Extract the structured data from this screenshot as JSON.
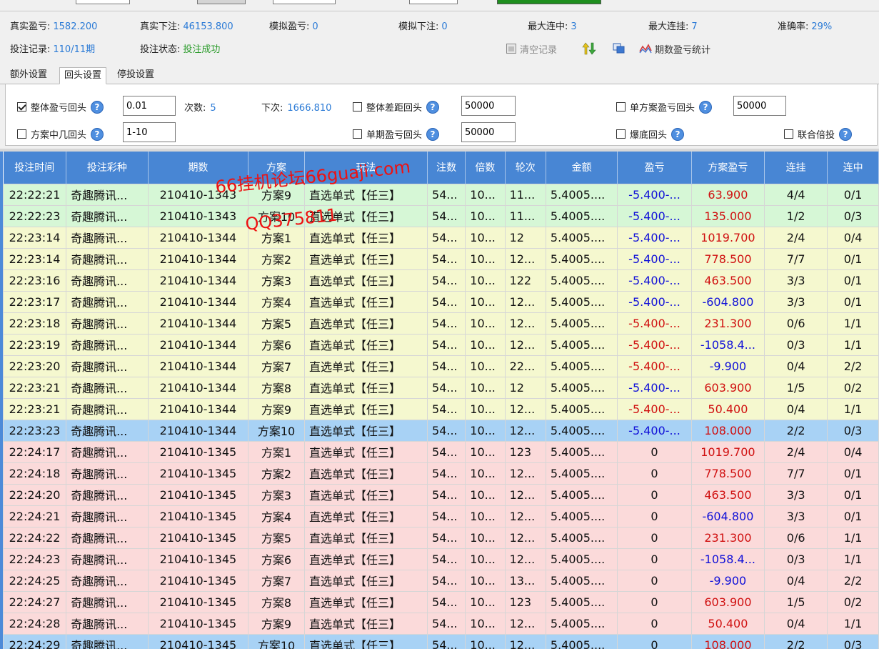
{
  "stats": {
    "row1": [
      {
        "label": "真实盈亏:",
        "value": "1582.200"
      },
      {
        "label": "真实下注:",
        "value": "46153.800"
      },
      {
        "label": "模拟盈亏:",
        "value": "0"
      },
      {
        "label": "模拟下注:",
        "value": "0"
      },
      {
        "label": "最大连中:",
        "value": "3"
      },
      {
        "label": "最大连挂:",
        "value": "7"
      },
      {
        "label": "准确率:",
        "value": "29%"
      }
    ],
    "row2": [
      {
        "label": "投注记录:",
        "value": "110/11期"
      },
      {
        "label": "投注状态:",
        "value": "投注成功"
      }
    ]
  },
  "toolbar": {
    "clear_label": "清空记录",
    "stats_label": "期数盈亏统计"
  },
  "tabs": [
    {
      "label": "额外设置",
      "active": false
    },
    {
      "label": "回头设置",
      "active": true
    },
    {
      "label": "停投设置",
      "active": false
    }
  ],
  "settings": {
    "overall_profit_return": {
      "label": "整体盈亏回头",
      "checked": true,
      "value": "0.01"
    },
    "count": {
      "label": "次数:",
      "value": "5"
    },
    "next": {
      "label": "下次:",
      "value": "1666.810"
    },
    "overall_gap_return": {
      "label": "整体差距回头",
      "checked": false,
      "value": "50000"
    },
    "single_plan_return": {
      "label": "单方案盈亏回头",
      "checked": false,
      "value": "50000"
    },
    "plan_hit_return": {
      "label": "方案中几回头",
      "checked": false,
      "value": "1-10"
    },
    "single_period_return": {
      "label": "单期盈亏回头",
      "checked": false,
      "value": "50000"
    },
    "bottom_out_return": {
      "label": "爆底回头",
      "checked": false
    },
    "joint_multiply": {
      "label": "联合倍投",
      "checked": false
    },
    "help_glyph": "?"
  },
  "table": {
    "columns": [
      "投注时间",
      "投注彩种",
      "期数",
      "方案",
      "玩法",
      "注数",
      "倍数",
      "轮次",
      "金额",
      "盈亏",
      "方案盈亏",
      "连挂",
      "连中"
    ],
    "rows": [
      {
        "time": "22:22:21",
        "lottery": "奇趣腾讯...",
        "period": "210410-1343",
        "plan": "方案9",
        "mode": "直选单式【任三】",
        "bets": "54...",
        "mult": "10...",
        "round": "11...",
        "amount": "5.4005....",
        "profit": "-5.400-...",
        "plan_profit": "63.900",
        "lose_streak": "4/4",
        "win_streak": "0/1",
        "style": "green",
        "profit_color": "blu",
        "plan_color": "neg"
      },
      {
        "time": "22:22:23",
        "lottery": "奇趣腾讯...",
        "period": "210410-1343",
        "plan": "方案10",
        "mode": "直选单式【任三】",
        "bets": "54...",
        "mult": "10...",
        "round": "11...",
        "amount": "5.4005....",
        "profit": "-5.400-...",
        "plan_profit": "135.000",
        "lose_streak": "1/2",
        "win_streak": "0/3",
        "style": "green",
        "profit_color": "blu",
        "plan_color": "neg"
      },
      {
        "time": "22:23:14",
        "lottery": "奇趣腾讯...",
        "period": "210410-1344",
        "plan": "方案1",
        "mode": "直选单式【任三】",
        "bets": "54...",
        "mult": "10...",
        "round": "12",
        "amount": "5.4005....",
        "profit": "-5.400-...",
        "plan_profit": "1019.700",
        "lose_streak": "2/4",
        "win_streak": "0/4",
        "style": "yellow",
        "profit_color": "blu",
        "plan_color": "neg"
      },
      {
        "time": "22:23:14",
        "lottery": "奇趣腾讯...",
        "period": "210410-1344",
        "plan": "方案2",
        "mode": "直选单式【任三】",
        "bets": "54...",
        "mult": "10...",
        "round": "12...",
        "amount": "5.4005....",
        "profit": "-5.400-...",
        "plan_profit": "778.500",
        "lose_streak": "7/7",
        "win_streak": "0/1",
        "style": "yellow",
        "profit_color": "blu",
        "plan_color": "neg"
      },
      {
        "time": "22:23:16",
        "lottery": "奇趣腾讯...",
        "period": "210410-1344",
        "plan": "方案3",
        "mode": "直选单式【任三】",
        "bets": "54...",
        "mult": "10...",
        "round": "122",
        "amount": "5.4005....",
        "profit": "-5.400-...",
        "plan_profit": "463.500",
        "lose_streak": "3/3",
        "win_streak": "0/1",
        "style": "yellow",
        "profit_color": "blu",
        "plan_color": "neg"
      },
      {
        "time": "22:23:17",
        "lottery": "奇趣腾讯...",
        "period": "210410-1344",
        "plan": "方案4",
        "mode": "直选单式【任三】",
        "bets": "54...",
        "mult": "10...",
        "round": "12...",
        "amount": "5.4005....",
        "profit": "-5.400-...",
        "plan_profit": "-604.800",
        "lose_streak": "3/3",
        "win_streak": "0/1",
        "style": "yellow",
        "profit_color": "blu",
        "plan_color": "blu"
      },
      {
        "time": "22:23:18",
        "lottery": "奇趣腾讯...",
        "period": "210410-1344",
        "plan": "方案5",
        "mode": "直选单式【任三】",
        "bets": "54...",
        "mult": "10...",
        "round": "12...",
        "amount": "5.4005....",
        "profit": "-5.400-...",
        "plan_profit": "231.300",
        "lose_streak": "0/6",
        "win_streak": "1/1",
        "style": "yellow",
        "profit_color": "neg",
        "plan_color": "neg"
      },
      {
        "time": "22:23:19",
        "lottery": "奇趣腾讯...",
        "period": "210410-1344",
        "plan": "方案6",
        "mode": "直选单式【任三】",
        "bets": "54...",
        "mult": "10...",
        "round": "12...",
        "amount": "5.4005....",
        "profit": "-5.400-...",
        "plan_profit": "-1058.4...",
        "lose_streak": "0/3",
        "win_streak": "1/1",
        "style": "yellow",
        "profit_color": "neg",
        "plan_color": "blu"
      },
      {
        "time": "22:23:20",
        "lottery": "奇趣腾讯...",
        "period": "210410-1344",
        "plan": "方案7",
        "mode": "直选单式【任三】",
        "bets": "54...",
        "mult": "10...",
        "round": "22...",
        "amount": "5.4005....",
        "profit": "-5.400-...",
        "plan_profit": "-9.900",
        "lose_streak": "0/4",
        "win_streak": "2/2",
        "style": "yellow",
        "profit_color": "neg",
        "plan_color": "blu"
      },
      {
        "time": "22:23:21",
        "lottery": "奇趣腾讯...",
        "period": "210410-1344",
        "plan": "方案8",
        "mode": "直选单式【任三】",
        "bets": "54...",
        "mult": "10...",
        "round": "12",
        "amount": "5.4005....",
        "profit": "-5.400-...",
        "plan_profit": "603.900",
        "lose_streak": "1/5",
        "win_streak": "0/2",
        "style": "yellow",
        "profit_color": "blu",
        "plan_color": "neg"
      },
      {
        "time": "22:23:21",
        "lottery": "奇趣腾讯...",
        "period": "210410-1344",
        "plan": "方案9",
        "mode": "直选单式【任三】",
        "bets": "54...",
        "mult": "10...",
        "round": "12...",
        "amount": "5.4005....",
        "profit": "-5.400-...",
        "plan_profit": "50.400",
        "lose_streak": "0/4",
        "win_streak": "1/1",
        "style": "yellow",
        "profit_color": "neg",
        "plan_color": "neg"
      },
      {
        "time": "22:23:23",
        "lottery": "奇趣腾讯...",
        "period": "210410-1344",
        "plan": "方案10",
        "mode": "直选单式【任三】",
        "bets": "54...",
        "mult": "10...",
        "round": "12...",
        "amount": "5.4005....",
        "profit": "-5.400-...",
        "plan_profit": "108.000",
        "lose_streak": "2/2",
        "win_streak": "0/3",
        "style": "blue",
        "profit_color": "blu",
        "plan_color": "neg"
      },
      {
        "time": "22:24:17",
        "lottery": "奇趣腾讯...",
        "period": "210410-1345",
        "plan": "方案1",
        "mode": "直选单式【任三】",
        "bets": "54...",
        "mult": "10...",
        "round": "123",
        "amount": "5.4005....",
        "profit": "0",
        "plan_profit": "1019.700",
        "lose_streak": "2/4",
        "win_streak": "0/4",
        "style": "pink",
        "profit_color": "",
        "plan_color": "neg"
      },
      {
        "time": "22:24:18",
        "lottery": "奇趣腾讯...",
        "period": "210410-1345",
        "plan": "方案2",
        "mode": "直选单式【任三】",
        "bets": "54...",
        "mult": "10...",
        "round": "12...",
        "amount": "5.4005....",
        "profit": "0",
        "plan_profit": "778.500",
        "lose_streak": "7/7",
        "win_streak": "0/1",
        "style": "pink",
        "profit_color": "",
        "plan_color": "neg"
      },
      {
        "time": "22:24:20",
        "lottery": "奇趣腾讯...",
        "period": "210410-1345",
        "plan": "方案3",
        "mode": "直选单式【任三】",
        "bets": "54...",
        "mult": "10...",
        "round": "12...",
        "amount": "5.4005....",
        "profit": "0",
        "plan_profit": "463.500",
        "lose_streak": "3/3",
        "win_streak": "0/1",
        "style": "pink",
        "profit_color": "",
        "plan_color": "neg"
      },
      {
        "time": "22:24:21",
        "lottery": "奇趣腾讯...",
        "period": "210410-1345",
        "plan": "方案4",
        "mode": "直选单式【任三】",
        "bets": "54...",
        "mult": "10...",
        "round": "12...",
        "amount": "5.4005....",
        "profit": "0",
        "plan_profit": "-604.800",
        "lose_streak": "3/3",
        "win_streak": "0/1",
        "style": "pink",
        "profit_color": "",
        "plan_color": "blu"
      },
      {
        "time": "22:24:22",
        "lottery": "奇趣腾讯...",
        "period": "210410-1345",
        "plan": "方案5",
        "mode": "直选单式【任三】",
        "bets": "54...",
        "mult": "10...",
        "round": "12...",
        "amount": "5.4005....",
        "profit": "0",
        "plan_profit": "231.300",
        "lose_streak": "0/6",
        "win_streak": "1/1",
        "style": "pink",
        "profit_color": "",
        "plan_color": "neg"
      },
      {
        "time": "22:24:23",
        "lottery": "奇趣腾讯...",
        "period": "210410-1345",
        "plan": "方案6",
        "mode": "直选单式【任三】",
        "bets": "54...",
        "mult": "10...",
        "round": "12...",
        "amount": "5.4005....",
        "profit": "0",
        "plan_profit": "-1058.4...",
        "lose_streak": "0/3",
        "win_streak": "1/1",
        "style": "pink",
        "profit_color": "",
        "plan_color": "blu"
      },
      {
        "time": "22:24:25",
        "lottery": "奇趣腾讯...",
        "period": "210410-1345",
        "plan": "方案7",
        "mode": "直选单式【任三】",
        "bets": "54...",
        "mult": "10...",
        "round": "13...",
        "amount": "5.4005....",
        "profit": "0",
        "plan_profit": "-9.900",
        "lose_streak": "0/4",
        "win_streak": "2/2",
        "style": "pink",
        "profit_color": "",
        "plan_color": "blu"
      },
      {
        "time": "22:24:27",
        "lottery": "奇趣腾讯...",
        "period": "210410-1345",
        "plan": "方案8",
        "mode": "直选单式【任三】",
        "bets": "54...",
        "mult": "10...",
        "round": "123",
        "amount": "5.4005....",
        "profit": "0",
        "plan_profit": "603.900",
        "lose_streak": "1/5",
        "win_streak": "0/2",
        "style": "pink",
        "profit_color": "",
        "plan_color": "neg"
      },
      {
        "time": "22:24:28",
        "lottery": "奇趣腾讯...",
        "period": "210410-1345",
        "plan": "方案9",
        "mode": "直选单式【任三】",
        "bets": "54...",
        "mult": "10...",
        "round": "12...",
        "amount": "5.4005....",
        "profit": "0",
        "plan_profit": "50.400",
        "lose_streak": "0/4",
        "win_streak": "1/1",
        "style": "pink",
        "profit_color": "",
        "plan_color": "neg"
      },
      {
        "time": "22:24:29",
        "lottery": "奇趣腾讯...",
        "period": "210410-1345",
        "plan": "方案10",
        "mode": "直选单式【任三】",
        "bets": "54...",
        "mult": "10...",
        "round": "12...",
        "amount": "5.4005....",
        "profit": "0",
        "plan_profit": "108.000",
        "lose_streak": "2/2",
        "win_streak": "0/3",
        "style": "blue",
        "profit_color": "",
        "plan_color": "neg"
      }
    ]
  },
  "watermark": {
    "line1": "66挂机论坛66guaji.com",
    "line2": "QQ375811"
  },
  "colors": {
    "header_blue": "#4886d4",
    "value_blue": "#2a7ad6",
    "negative_red": "#d01010",
    "status_green": "#2a9b2a"
  }
}
